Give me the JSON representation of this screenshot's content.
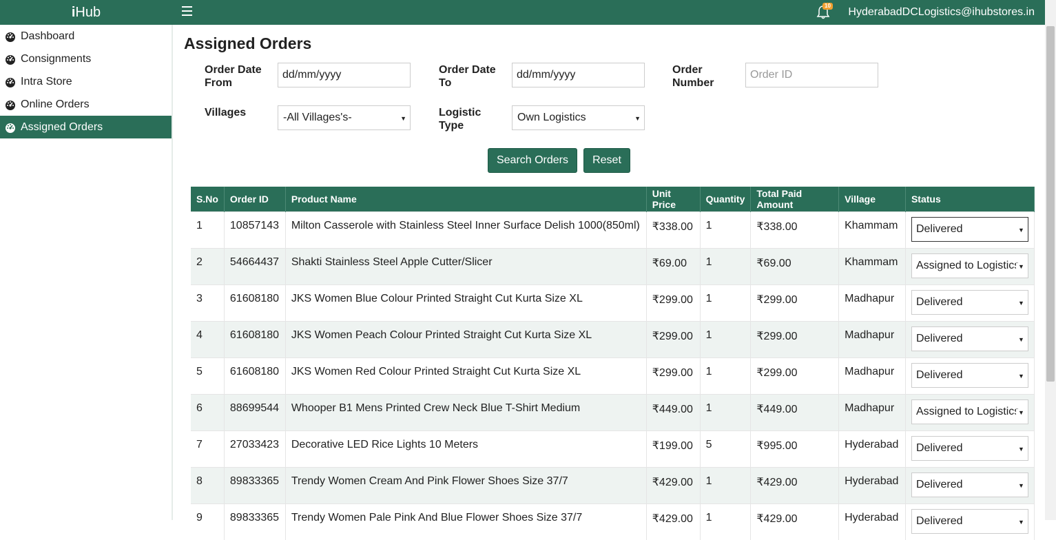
{
  "header": {
    "brand_prefix": "i",
    "brand_suffix": "Hub",
    "notification_count": "10",
    "user_email": "HyderabadDCLogistics@ihubstores.in"
  },
  "sidebar": {
    "items": [
      {
        "label": "Dashboard",
        "active": false
      },
      {
        "label": "Consignments",
        "active": false
      },
      {
        "label": "Intra Store",
        "active": false
      },
      {
        "label": "Online Orders",
        "active": false
      },
      {
        "label": "Assigned Orders",
        "active": true
      }
    ]
  },
  "page": {
    "title": "Assigned Orders"
  },
  "filters": {
    "order_date_from_label_1": "Order Date",
    "order_date_from_label_2": "From",
    "order_date_from_value": "dd/mm/yyyy",
    "order_date_to_label_1": "Order Date",
    "order_date_to_label_2": "To",
    "order_date_to_value": "dd/mm/yyyy",
    "order_number_label_1": "Order",
    "order_number_label_2": "Number",
    "order_number_placeholder": "Order ID",
    "villages_label": "Villages",
    "villages_value": "-All Villages's-",
    "logistic_type_label_1": "Logistic",
    "logistic_type_label_2": "Type",
    "logistic_type_value": "Own Logistics",
    "search_button": "Search Orders",
    "reset_button": "Reset"
  },
  "table": {
    "columns": [
      "S.No",
      "Order ID",
      "Product Name",
      "Unit Price",
      "Quantity",
      "Total Paid Amount",
      "Village",
      "Status"
    ],
    "rows": [
      {
        "sno": "1",
        "order_id": "10857143",
        "product": "Milton Casserole with Stainless Steel Inner Surface Delish 1000(850ml)",
        "unit_price": "₹338.00",
        "qty": "1",
        "total": "₹338.00",
        "village": "Khammam",
        "status": "Delivered"
      },
      {
        "sno": "2",
        "order_id": "54664437",
        "product": "Shakti Stainless Steel Apple Cutter/Slicer",
        "unit_price": "₹69.00",
        "qty": "1",
        "total": "₹69.00",
        "village": "Khammam",
        "status": "Assigned to Logistics"
      },
      {
        "sno": "3",
        "order_id": "61608180",
        "product": "JKS Women Blue Colour Printed Straight Cut Kurta Size XL",
        "unit_price": "₹299.00",
        "qty": "1",
        "total": "₹299.00",
        "village": "Madhapur",
        "status": "Delivered"
      },
      {
        "sno": "4",
        "order_id": "61608180",
        "product": "JKS Women Peach Colour Printed Straight Cut Kurta Size XL",
        "unit_price": "₹299.00",
        "qty": "1",
        "total": "₹299.00",
        "village": "Madhapur",
        "status": "Delivered"
      },
      {
        "sno": "5",
        "order_id": "61608180",
        "product": "JKS Women Red Colour Printed Straight Cut Kurta Size XL",
        "unit_price": "₹299.00",
        "qty": "1",
        "total": "₹299.00",
        "village": "Madhapur",
        "status": "Delivered"
      },
      {
        "sno": "6",
        "order_id": "88699544",
        "product": "Whooper B1 Mens Printed Crew Neck Blue T-Shirt Medium",
        "unit_price": "₹449.00",
        "qty": "1",
        "total": "₹449.00",
        "village": "Madhapur",
        "status": "Assigned to Logistics"
      },
      {
        "sno": "7",
        "order_id": "27033423",
        "product": "Decorative LED Rice Lights 10 Meters",
        "unit_price": "₹199.00",
        "qty": "5",
        "total": "₹995.00",
        "village": "Hyderabad",
        "status": "Delivered"
      },
      {
        "sno": "8",
        "order_id": "89833365",
        "product": "Trendy Women Cream And Pink Flower Shoes Size 37/7",
        "unit_price": "₹429.00",
        "qty": "1",
        "total": "₹429.00",
        "village": "Hyderabad",
        "status": "Delivered"
      },
      {
        "sno": "9",
        "order_id": "89833365",
        "product": "Trendy Women Pale Pink And Blue Flower Shoes Size 37/7",
        "unit_price": "₹429.00",
        "qty": "1",
        "total": "₹429.00",
        "village": "Hyderabad",
        "status": "Delivered"
      }
    ]
  },
  "colors": {
    "primary": "#2a6e58",
    "badge": "#f0a030",
    "row_alt": "#eef3f1"
  }
}
